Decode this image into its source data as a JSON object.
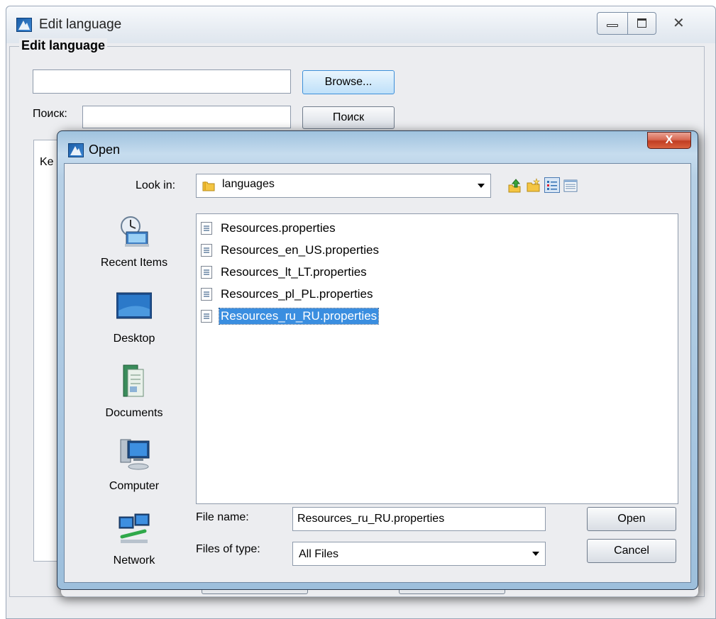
{
  "background_window": {
    "title": "Edit language",
    "group_label": "Edit language",
    "path_value": "",
    "browse_label": "Browse...",
    "search_label": "Поиск:",
    "search_value": "",
    "search_button_label": "Поиск",
    "table_header_partial": "Ke"
  },
  "open_dialog": {
    "title": "Open",
    "close_label": "X",
    "look_in_label": "Look in:",
    "look_in_value": "languages",
    "places": [
      {
        "label": "Recent Items",
        "icon": "recent-items-icon"
      },
      {
        "label": "Desktop",
        "icon": "desktop-icon"
      },
      {
        "label": "Documents",
        "icon": "documents-icon"
      },
      {
        "label": "Computer",
        "icon": "computer-icon"
      },
      {
        "label": "Network",
        "icon": "network-icon"
      }
    ],
    "files": [
      {
        "name": "Resources.properties",
        "selected": false
      },
      {
        "name": "Resources_en_US.properties",
        "selected": false
      },
      {
        "name": "Resources_lt_LT.properties",
        "selected": false
      },
      {
        "name": "Resources_pl_PL.properties",
        "selected": false
      },
      {
        "name": "Resources_ru_RU.properties",
        "selected": true
      }
    ],
    "file_name_label": "File name:",
    "file_name_value": "Resources_ru_RU.properties",
    "files_of_type_label": "Files of type:",
    "files_of_type_value": "All Files",
    "open_label": "Open",
    "cancel_label": "Cancel"
  },
  "colors": {
    "selection": "#3a8ee0",
    "dialog_frame": "#a9c7e1",
    "close_button": "#c13e22"
  }
}
